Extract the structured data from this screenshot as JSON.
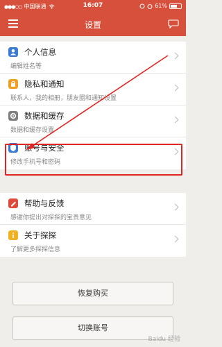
{
  "status_bar": {
    "carrier": "中国联通",
    "time": "16:07",
    "battery": "61%",
    "battery_level": 0.61
  },
  "header": {
    "title": "设置"
  },
  "groups": [
    {
      "items": [
        {
          "title": "个人信息",
          "subtitle": "编辑姓名等",
          "icon": "person-icon",
          "color": "#3a7bd5"
        },
        {
          "title": "隐私和通知",
          "subtitle": "联系人，我的相册，朋友圈和通知设置",
          "icon": "lock-icon",
          "color": "#f0a020"
        },
        {
          "title": "数据和缓存",
          "subtitle": "数据和缓存设置",
          "icon": "gear-icon",
          "color": "#808080"
        },
        {
          "title": "账号与安全",
          "subtitle": "修改手机号和密码",
          "icon": "shield-icon",
          "color": "#3a7bd5"
        }
      ]
    },
    {
      "items": [
        {
          "title": "帮助与反馈",
          "subtitle": "感谢你提出对探探的宝贵意见",
          "icon": "pencil-icon",
          "color": "#e04a3a"
        },
        {
          "title": "关于探探",
          "subtitle": "了解更多探探信息",
          "icon": "info-icon",
          "color": "#f0b020"
        }
      ]
    }
  ],
  "buttons": {
    "restore": "恢复购买",
    "switch": "切换账号"
  },
  "watermark": "Baidu 经验"
}
